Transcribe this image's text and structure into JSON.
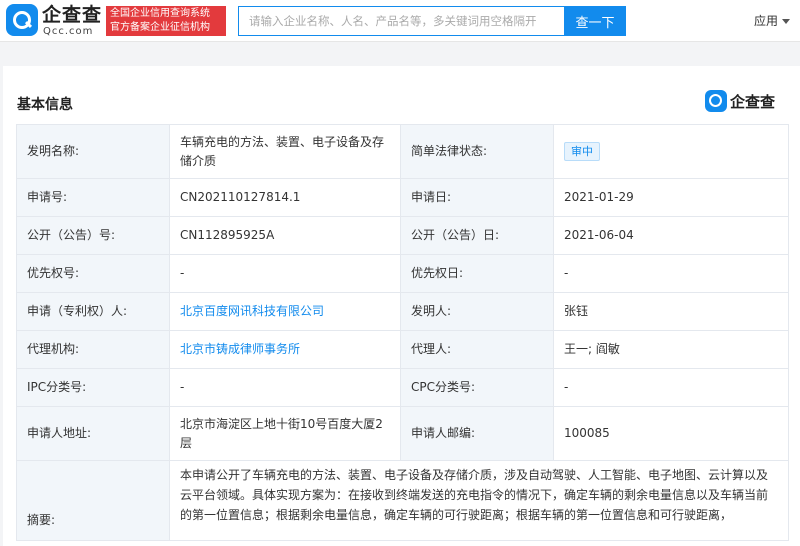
{
  "header": {
    "logo_name": "企查查",
    "logo_domain": "Qcc.com",
    "badge_line1": "全国企业信用查询系统",
    "badge_line2": "官方备案企业征信机构",
    "search_placeholder": "请输入企业名称、人名、产品名等，多关键词用空格隔开",
    "search_button": "查一下",
    "app_menu": "应用"
  },
  "section": {
    "title": "基本信息",
    "watermark": "企查查"
  },
  "table": {
    "invention_name_label": "发明名称:",
    "invention_name": "车辆充电的方法、装置、电子设备及存储介质",
    "legal_status_label": "简单法律状态:",
    "legal_status": "审中",
    "application_no_label": "申请号:",
    "application_no": "CN202110127814.1",
    "application_date_label": "申请日:",
    "application_date": "2021-01-29",
    "publication_no_label": "公开（公告）号:",
    "publication_no": "CN112895925A",
    "publication_date_label": "公开（公告）日:",
    "publication_date": "2021-06-04",
    "priority_no_label": "优先权号:",
    "priority_no": "-",
    "priority_date_label": "优先权日:",
    "priority_date": "-",
    "applicant_label": "申请（专利权）人:",
    "applicant": "北京百度网讯科技有限公司",
    "inventor_label": "发明人:",
    "inventor": "张钰",
    "agency_label": "代理机构:",
    "agency": "北京市铸成律师事务所",
    "agent_label": "代理人:",
    "agent": "王一; 阎敏",
    "ipc_label": "IPC分类号:",
    "ipc": "-",
    "cpc_label": "CPC分类号:",
    "cpc": "-",
    "address_label": "申请人地址:",
    "address": "北京市海淀区上地十街10号百度大厦2层",
    "postcode_label": "申请人邮编:",
    "postcode": "100085",
    "abstract_label": "摘要:",
    "abstract": "本申请公开了车辆充电的方法、装置、电子设备及存储介质，涉及自动驾驶、人工智能、电子地图、云计算以及云平台领域。具体实现方案为：在接收到终端发送的充电指令的情况下，确定车辆的剩余电量信息以及车辆当前的第一位置信息；根据剩余电量信息，确定车辆的可行驶距离；根据车辆的第一位置信息和可行驶距离，"
  },
  "colors": {
    "brand_blue": "#128bed",
    "badge_red": "#e33a3d",
    "label_bg": "#f2f6fa"
  }
}
